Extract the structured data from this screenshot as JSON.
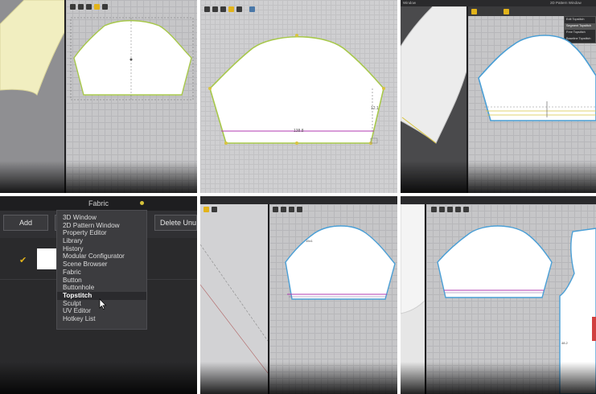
{
  "fabric_panel": {
    "title": "Fabric",
    "add_button": "Add",
    "delete_button": "Delete Unuse",
    "menu_items": [
      "3D Window",
      "2D Pattern Window",
      "Property Editor",
      "Library",
      "History",
      "Modular Configurator",
      "Scene Browser",
      "Fabric",
      "Button",
      "Buttonhole",
      "Topstitch",
      "Sculpt",
      "UV Editor",
      "Hotkey List"
    ],
    "active_item": "Topstitch"
  },
  "pattern_tabs": {
    "p3_window": "Window",
    "p3_title": "2D Pattern Window",
    "p3_menu": [
      "Edit Topstitch",
      "Segment Topstitch",
      "Free Topstitch",
      "Baseline Topstitch"
    ]
  },
  "measurements": {
    "p2_width": "138.8",
    "p2_height": "12.1",
    "p5_label": "15x1",
    "p6_label": "48.2"
  },
  "colors": {
    "outline_green": "#a7c84a",
    "outline_blue": "#4a9fd6",
    "topstitch_magenta": "#b03ab0",
    "yellow_line": "#d8c440",
    "accent_yellow": "#e2b31a"
  },
  "icons": [
    "select-icon",
    "transform-icon",
    "edit-icon",
    "sew-icon",
    "fabric-icon",
    "avatar-icon"
  ]
}
